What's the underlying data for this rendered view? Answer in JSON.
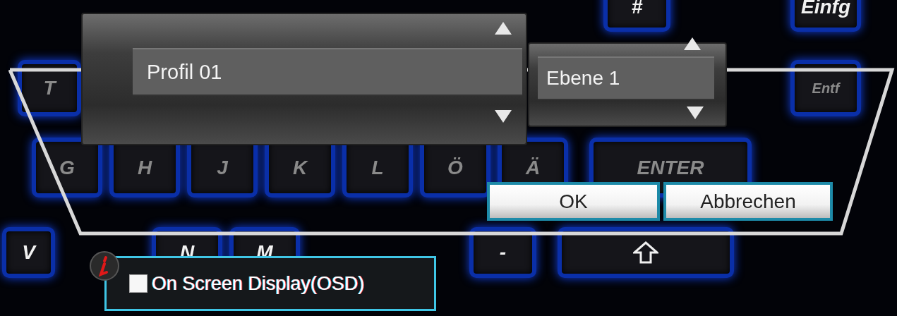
{
  "keyboard": {
    "keys": [
      {
        "label": "#",
        "kind": "bright"
      },
      {
        "label": "Einfg",
        "kind": "bright"
      },
      {
        "label": "T",
        "kind": "dim"
      },
      {
        "label": "Entf",
        "kind": "dim"
      },
      {
        "label": "G",
        "kind": "dim"
      },
      {
        "label": "H",
        "kind": "dim"
      },
      {
        "label": "J",
        "kind": "dim"
      },
      {
        "label": "K",
        "kind": "dim"
      },
      {
        "label": "L",
        "kind": "dim"
      },
      {
        "label": "Ö",
        "kind": "dim"
      },
      {
        "label": "Ä",
        "kind": "dim"
      },
      {
        "label": "ENTER",
        "kind": "dim"
      },
      {
        "label": "V",
        "kind": "bright"
      },
      {
        "label": "N",
        "kind": "bright"
      },
      {
        "label": "M",
        "kind": "bright"
      },
      {
        "label": "-",
        "kind": "bright"
      }
    ]
  },
  "profile_selector": {
    "value": "Profil 01"
  },
  "layer_selector": {
    "value": "Ebene 1"
  },
  "buttons": [
    {
      "label": "OK"
    },
    {
      "label": "Abbrechen"
    }
  ],
  "osd": {
    "label": "On Screen Display(OSD)",
    "checked": false
  }
}
